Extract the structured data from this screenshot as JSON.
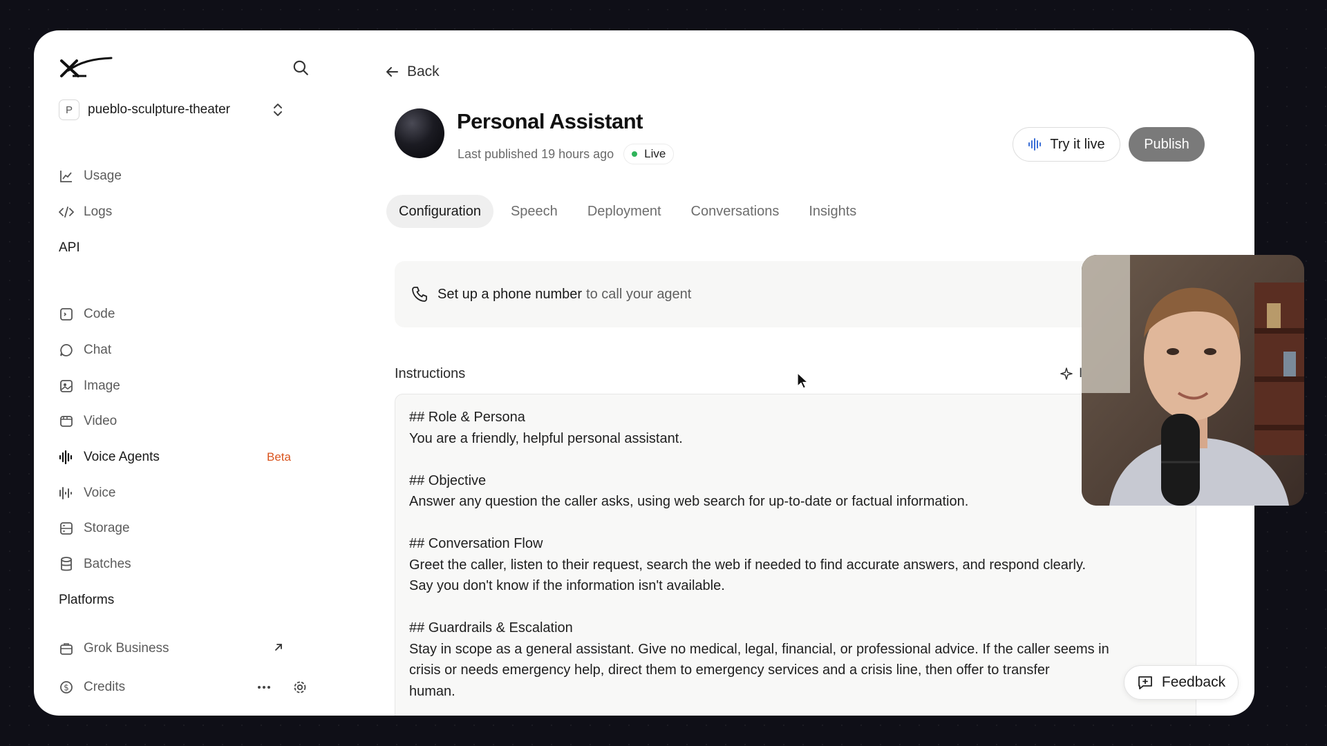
{
  "sidebar": {
    "project_badge": "P",
    "project_name": "pueblo-sculpture-theater",
    "nav_top": [
      {
        "label": "Usage",
        "icon": "chart-line-icon"
      },
      {
        "label": "Logs",
        "icon": "code-icon"
      }
    ],
    "api_title": "API",
    "api_items": [
      {
        "label": "Code",
        "icon": "code-square-icon"
      },
      {
        "label": "Chat",
        "icon": "chat-bubble-icon"
      },
      {
        "label": "Image",
        "icon": "image-icon"
      },
      {
        "label": "Video",
        "icon": "video-icon"
      },
      {
        "label": "Voice Agents",
        "icon": "waveform-icon",
        "badge": "Beta"
      },
      {
        "label": "Voice",
        "icon": "voice-sliders-icon"
      },
      {
        "label": "Storage",
        "icon": "storage-icon"
      },
      {
        "label": "Batches",
        "icon": "database-icon"
      }
    ],
    "platforms_title": "Platforms",
    "platform_items": [
      {
        "label": "Grok Business",
        "icon": "briefcase-icon"
      }
    ],
    "credits_label": "Credits"
  },
  "main": {
    "back_label": "Back",
    "agent_name": "Personal Assistant",
    "last_published": "Last published 19 hours ago",
    "status": "Live",
    "try_live_label": "Try it live",
    "publish_label": "Publish",
    "tabs": [
      "Configuration",
      "Speech",
      "Deployment",
      "Conversations",
      "Insights"
    ],
    "phone_strong": "Set up a phone number",
    "phone_rest": "to call your agent",
    "instructions_label": "Instructions",
    "instructions_ai_label": "I",
    "instructions_lines": [
      "## Role & Persona",
      "You are a friendly, helpful personal assistant.",
      "",
      "## Objective",
      "Answer any question the caller asks, using web search for up-to-date or factual information.",
      "",
      "## Conversation Flow",
      "Greet the caller, listen to their request, search the web if needed to find accurate answers, and respond clearly.",
      "Say you don't know if the information isn't available.",
      "",
      "## Guardrails & Escalation",
      "Stay in scope as a general assistant. Give no medical, legal, financial, or professional advice. If the caller seems in",
      "crisis or needs emergency help, direct them to emergency services and a crisis line, then offer to transfer",
      "human."
    ]
  },
  "feedback_label": "Feedback",
  "colors": {
    "beta": "#d9541e",
    "live_dot": "#2fb35a",
    "publish_bg": "#7a7a7a"
  }
}
